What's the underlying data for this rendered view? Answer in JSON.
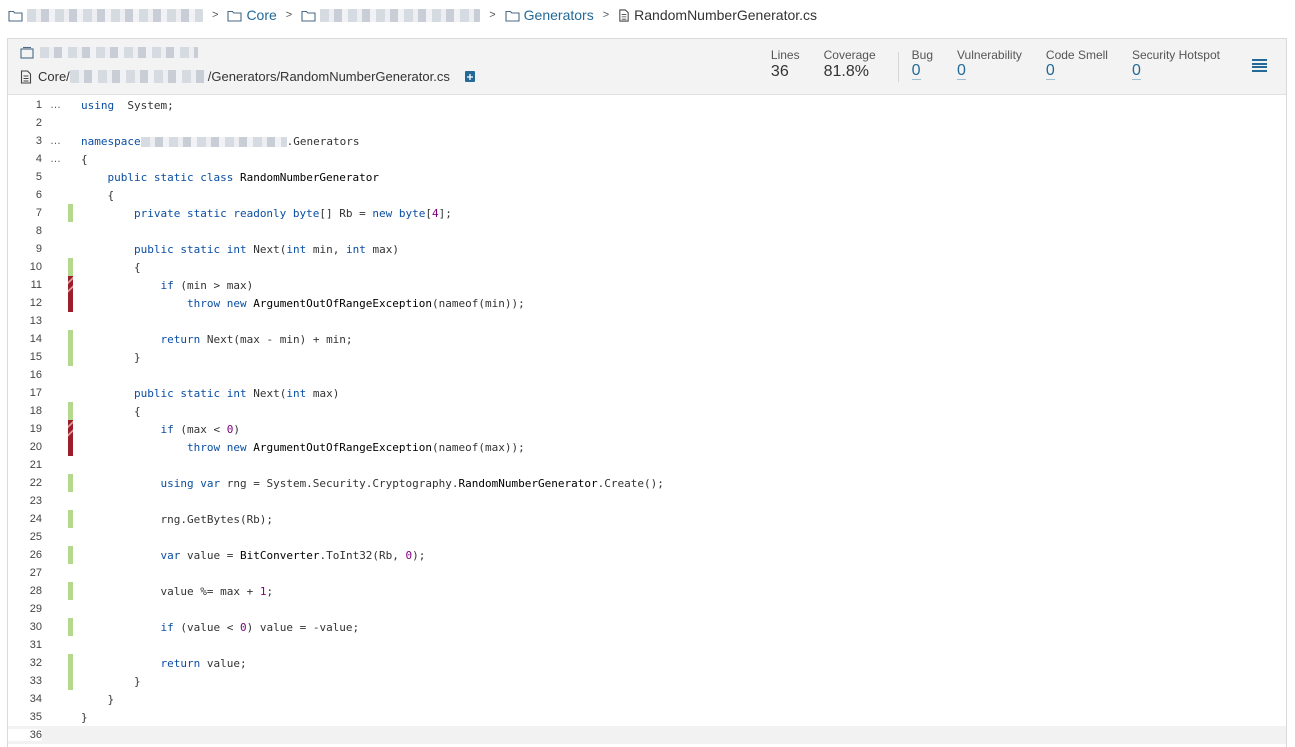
{
  "breadcrumb": {
    "items": [
      {
        "label": "",
        "blurred": true,
        "current": false
      },
      {
        "label": "Core",
        "blurred": false,
        "current": false
      },
      {
        "label": "",
        "blurred": true,
        "current": false
      },
      {
        "label": "Generators",
        "blurred": false,
        "current": false
      },
      {
        "label": "RandomNumberGenerator.cs",
        "blurred": false,
        "current": true
      }
    ],
    "separator": ">"
  },
  "file_header": {
    "path_prefix": "Core/",
    "path_suffix": "/Generators/RandomNumberGenerator.cs"
  },
  "measures": [
    {
      "label": "Lines",
      "value": "36",
      "link": false
    },
    {
      "label": "Coverage",
      "value": "81.8%",
      "link": false
    },
    {
      "label": "Bug",
      "value": "0",
      "link": true
    },
    {
      "label": "Vulnerability",
      "value": "0",
      "link": true
    },
    {
      "label": "Code Smell",
      "value": "0",
      "link": true
    },
    {
      "label": "Security Hotspot",
      "value": "0",
      "link": true
    }
  ],
  "colors": {
    "link": "#236a97",
    "covered": "#b4d98c",
    "uncovered": "#9c1e2b",
    "keyword": "#0b4ea2"
  },
  "code_lines": [
    {
      "n": "1",
      "dots": true,
      "cov": "",
      "tokens": [
        [
          "kw",
          "using"
        ],
        [
          "",
          "  System;"
        ]
      ]
    },
    {
      "n": "2",
      "dots": false,
      "cov": "",
      "tokens": []
    },
    {
      "n": "3",
      "dots": true,
      "cov": "",
      "tokens": [
        [
          "kw",
          "namespace"
        ],
        [
          "blur",
          ""
        ],
        [
          "",
          ".Generators"
        ]
      ]
    },
    {
      "n": "4",
      "dots": true,
      "cov": "",
      "tokens": [
        [
          "",
          "{"
        ]
      ]
    },
    {
      "n": "5",
      "dots": false,
      "cov": "",
      "tokens": [
        [
          "",
          "    "
        ],
        [
          "kw",
          "public static class"
        ],
        [
          "cls",
          " RandomNumberGenerator"
        ]
      ]
    },
    {
      "n": "6",
      "dots": false,
      "cov": "",
      "tokens": [
        [
          "",
          "    {"
        ]
      ]
    },
    {
      "n": "7",
      "dots": false,
      "cov": "covered",
      "tokens": [
        [
          "",
          "        "
        ],
        [
          "kw",
          "private static readonly byte"
        ],
        [
          "",
          "[] Rb = "
        ],
        [
          "kw",
          "new byte"
        ],
        [
          "",
          "["
        ],
        [
          "num",
          "4"
        ],
        [
          "",
          "];"
        ]
      ]
    },
    {
      "n": "8",
      "dots": false,
      "cov": "",
      "tokens": []
    },
    {
      "n": "9",
      "dots": false,
      "cov": "",
      "tokens": [
        [
          "",
          "        "
        ],
        [
          "kw",
          "public static int"
        ],
        [
          "",
          " Next("
        ],
        [
          "kw",
          "int"
        ],
        [
          "",
          " min, "
        ],
        [
          "kw",
          "int"
        ],
        [
          "",
          " max)"
        ]
      ]
    },
    {
      "n": "10",
      "dots": false,
      "cov": "covered",
      "tokens": [
        [
          "",
          "        {"
        ]
      ]
    },
    {
      "n": "11",
      "dots": false,
      "cov": "partial",
      "tokens": [
        [
          "",
          "            "
        ],
        [
          "kw",
          "if"
        ],
        [
          "",
          " (min > max)"
        ]
      ]
    },
    {
      "n": "12",
      "dots": false,
      "cov": "uncovered",
      "tokens": [
        [
          "",
          "                "
        ],
        [
          "kw",
          "throw new"
        ],
        [
          "cls",
          " ArgumentOutOfRangeException"
        ],
        [
          "",
          "(nameof(min));"
        ]
      ]
    },
    {
      "n": "13",
      "dots": false,
      "cov": "",
      "tokens": []
    },
    {
      "n": "14",
      "dots": false,
      "cov": "covered",
      "tokens": [
        [
          "",
          "            "
        ],
        [
          "kw",
          "return"
        ],
        [
          "",
          " Next(max - min) + min;"
        ]
      ]
    },
    {
      "n": "15",
      "dots": false,
      "cov": "covered",
      "tokens": [
        [
          "",
          "        }"
        ]
      ]
    },
    {
      "n": "16",
      "dots": false,
      "cov": "",
      "tokens": []
    },
    {
      "n": "17",
      "dots": false,
      "cov": "",
      "tokens": [
        [
          "",
          "        "
        ],
        [
          "kw",
          "public static int"
        ],
        [
          "",
          " Next("
        ],
        [
          "kw",
          "int"
        ],
        [
          "",
          " max)"
        ]
      ]
    },
    {
      "n": "18",
      "dots": false,
      "cov": "covered",
      "tokens": [
        [
          "",
          "        {"
        ]
      ]
    },
    {
      "n": "19",
      "dots": false,
      "cov": "partial",
      "tokens": [
        [
          "",
          "            "
        ],
        [
          "kw",
          "if"
        ],
        [
          "",
          " (max < "
        ],
        [
          "num",
          "0"
        ],
        [
          "",
          ")"
        ]
      ]
    },
    {
      "n": "20",
      "dots": false,
      "cov": "uncovered",
      "tokens": [
        [
          "",
          "                "
        ],
        [
          "kw",
          "throw new"
        ],
        [
          "cls",
          " ArgumentOutOfRangeException"
        ],
        [
          "",
          "(nameof(max));"
        ]
      ]
    },
    {
      "n": "21",
      "dots": false,
      "cov": "",
      "tokens": []
    },
    {
      "n": "22",
      "dots": false,
      "cov": "covered",
      "tokens": [
        [
          "",
          "            "
        ],
        [
          "kw",
          "using var"
        ],
        [
          "",
          " rng = System.Security.Cryptography."
        ],
        [
          "cls",
          "RandomNumberGenerator"
        ],
        [
          "",
          ".Create();"
        ]
      ]
    },
    {
      "n": "23",
      "dots": false,
      "cov": "",
      "tokens": []
    },
    {
      "n": "24",
      "dots": false,
      "cov": "covered",
      "tokens": [
        [
          "",
          "            rng.GetBytes(Rb);"
        ]
      ]
    },
    {
      "n": "25",
      "dots": false,
      "cov": "",
      "tokens": []
    },
    {
      "n": "26",
      "dots": false,
      "cov": "covered",
      "tokens": [
        [
          "",
          "            "
        ],
        [
          "kw",
          "var"
        ],
        [
          "",
          " value = "
        ],
        [
          "cls",
          "BitConverter"
        ],
        [
          "",
          ".ToInt32(Rb, "
        ],
        [
          "num",
          "0"
        ],
        [
          "",
          ");"
        ]
      ]
    },
    {
      "n": "27",
      "dots": false,
      "cov": "",
      "tokens": []
    },
    {
      "n": "28",
      "dots": false,
      "cov": "covered",
      "tokens": [
        [
          "",
          "            value %= max + "
        ],
        [
          "num",
          "1"
        ],
        [
          "",
          ";"
        ]
      ]
    },
    {
      "n": "29",
      "dots": false,
      "cov": "",
      "tokens": []
    },
    {
      "n": "30",
      "dots": false,
      "cov": "covered",
      "tokens": [
        [
          "",
          "            "
        ],
        [
          "kw",
          "if"
        ],
        [
          "",
          " (value < "
        ],
        [
          "num",
          "0"
        ],
        [
          "",
          ") value = -value;"
        ]
      ]
    },
    {
      "n": "31",
      "dots": false,
      "cov": "",
      "tokens": []
    },
    {
      "n": "32",
      "dots": false,
      "cov": "covered",
      "tokens": [
        [
          "",
          "            "
        ],
        [
          "kw",
          "return"
        ],
        [
          "",
          " value;"
        ]
      ]
    },
    {
      "n": "33",
      "dots": false,
      "cov": "covered",
      "tokens": [
        [
          "",
          "        }"
        ]
      ]
    },
    {
      "n": "34",
      "dots": false,
      "cov": "",
      "tokens": [
        [
          "",
          "    }"
        ]
      ]
    },
    {
      "n": "35",
      "dots": false,
      "cov": "",
      "tokens": [
        [
          "",
          "}"
        ]
      ]
    },
    {
      "n": "36",
      "dots": false,
      "cov": "",
      "tokens": []
    }
  ]
}
